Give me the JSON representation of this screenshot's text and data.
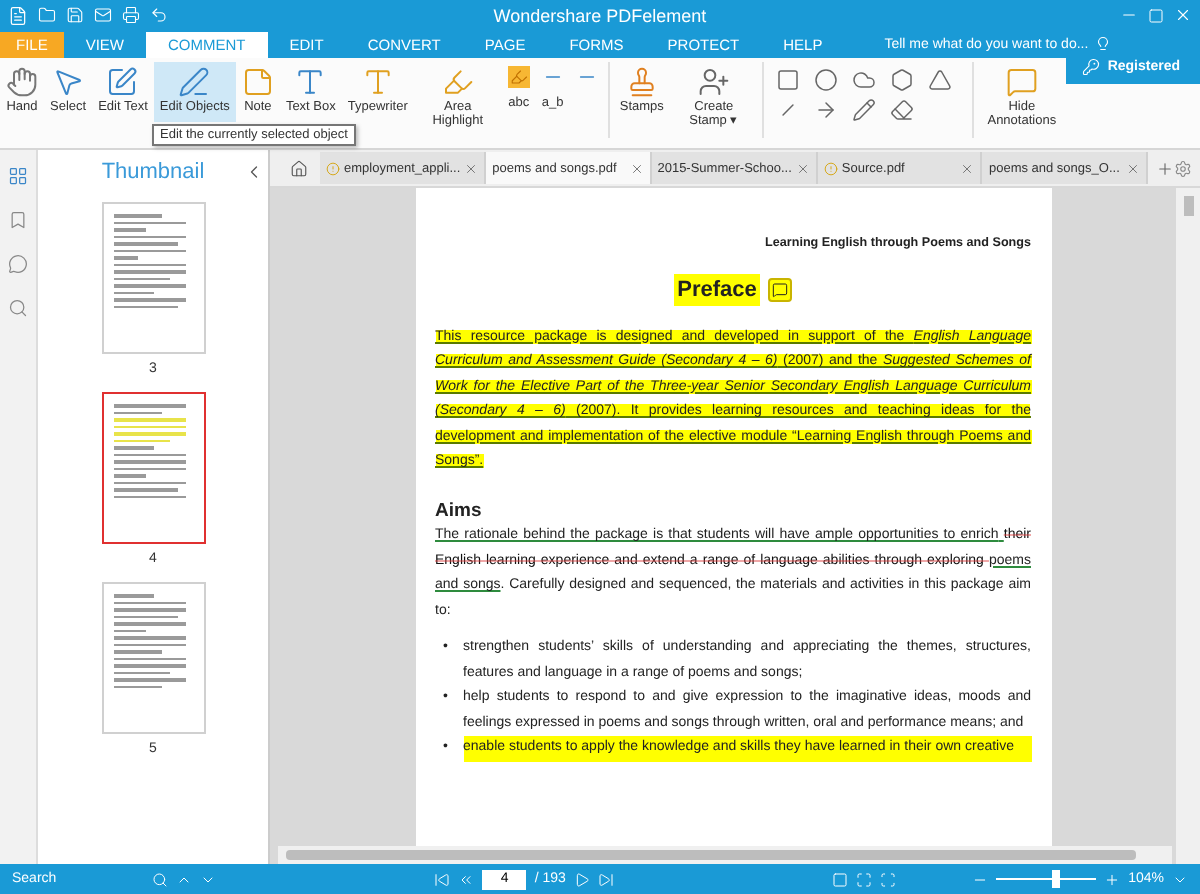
{
  "window": {
    "title": "Wondershare PDFelement"
  },
  "menu": {
    "file": "FILE",
    "tabs": [
      {
        "label": "VIEW",
        "selected": false
      },
      {
        "label": "COMMENT",
        "selected": true
      },
      {
        "label": "EDIT",
        "selected": false
      },
      {
        "label": "CONVERT",
        "selected": false
      },
      {
        "label": "PAGE",
        "selected": false
      },
      {
        "label": "FORMS",
        "selected": false
      },
      {
        "label": "PROTECT",
        "selected": false
      },
      {
        "label": "HELP",
        "selected": false
      }
    ],
    "search_placeholder": "Tell me what do you want to do..."
  },
  "account": {
    "label": "Registered"
  },
  "ribbon": {
    "tools": [
      {
        "label": "Hand",
        "selected": false
      },
      {
        "label": "Select",
        "selected": false
      },
      {
        "label": "Edit Text",
        "selected": false
      },
      {
        "label": "Edit Objects",
        "selected": true
      },
      {
        "label": "Note",
        "selected": false
      },
      {
        "label": "Text Box",
        "selected": false
      },
      {
        "label": "Typewriter",
        "selected": false
      },
      {
        "label": "Area Highlight",
        "selected": false
      }
    ],
    "markups": [
      "abc",
      "a_b"
    ],
    "stamps": [
      "Stamps",
      "Create Stamp ▾"
    ],
    "hide": "Hide Annotations"
  },
  "tooltip": "Edit the currently selected object",
  "sidebar": {
    "title": "Thumbnail",
    "pages": [
      {
        "label": "3",
        "selected": false
      },
      {
        "label": "4",
        "selected": true
      },
      {
        "label": "5",
        "selected": false
      }
    ]
  },
  "doc_tabs": [
    {
      "label": "employment_appli...",
      "warning": true,
      "selected": false
    },
    {
      "label": "poems and songs.pdf",
      "warning": false,
      "selected": true
    },
    {
      "label": "2015-Summer-Schoo...",
      "warning": false,
      "selected": false
    },
    {
      "label": "Source.pdf",
      "warning": true,
      "selected": false
    },
    {
      "label": "poems and songs_O...",
      "warning": false,
      "selected": false
    }
  ],
  "document": {
    "header": "Learning English through Poems and Songs",
    "title": "Preface",
    "intro": "This resource package is designed and developed in support of the *English Language Curriculum and Assessment Guide (Secondary 4 – 6)* (2007) and the *Suggested Schemes of Work for the Elective Part of the Three-year Senior Secondary English Language Curriculum (Secondary 4 – 6)* (2007). It provides learning resources and teaching ideas for the development and implementation of the elective module “Learning English through Poems and Songs”.",
    "aims_heading": "Aims",
    "aims_segments": [
      {
        "kind": "underline",
        "text": "The rationale behind the package is that students will have ample opportunities to enrich"
      },
      {
        "kind": "strike",
        "text": "their English learning experience and extend a range of language abilities through exploring"
      },
      {
        "kind": "underline",
        "text": "poems and songs"
      },
      {
        "kind": "plain",
        "text": ". Carefully designed and sequenced, the materials and activities in this package aim to:"
      }
    ],
    "bullets": [
      {
        "marker": "•",
        "text": "strengthen students’ skills of understanding and appreciating the themes, structures, features and language in a range of poems and songs;",
        "highlighted": false
      },
      {
        "marker": "•",
        "text": "help students to respond to and give expression to the imaginative ideas, moods and feelings expressed in poems and songs through written, oral and performance means; and",
        "highlighted": false
      },
      {
        "marker": "•",
        "text": "enable students to apply the knowledge and skills they have learned in their own creative",
        "highlighted": true
      }
    ]
  },
  "status": {
    "search": "Search",
    "page": "4",
    "total": "/ 193",
    "zoom": {
      "level": 0.6
    },
    "zoom_reading": "104%"
  }
}
